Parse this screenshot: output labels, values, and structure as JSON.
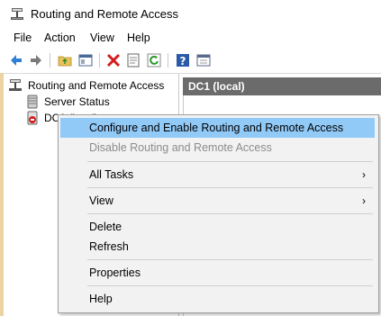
{
  "window": {
    "title": "Routing and Remote Access"
  },
  "menu": [
    "File",
    "Action",
    "View",
    "Help"
  ],
  "toolbar": {
    "buttons": [
      "back-icon",
      "forward-icon",
      "up-folder-icon",
      "show-hide-tree-icon",
      "delete-icon",
      "properties-icon",
      "refresh-icon",
      "help-icon",
      "console-icon"
    ]
  },
  "tree": {
    "root_label": "Routing and Remote Access",
    "items": [
      "Server Status",
      "DC1 (local)"
    ]
  },
  "right_pane": {
    "header": "DC1 (local)"
  },
  "context_menu": {
    "items": [
      {
        "label": "Configure and Enable Routing and Remote Access",
        "state": "highlighted"
      },
      {
        "label": "Disable Routing and Remote Access",
        "state": "disabled"
      },
      {
        "label": "All Tasks",
        "submenu": true
      },
      {
        "label": "View",
        "submenu": true
      },
      {
        "label": "Delete"
      },
      {
        "label": "Refresh"
      },
      {
        "label": "Properties"
      },
      {
        "label": "Help"
      }
    ],
    "submenu_arrow": "›"
  },
  "colors": {
    "highlight": "#91c9f7",
    "pane_header": "#6b6b6b"
  }
}
